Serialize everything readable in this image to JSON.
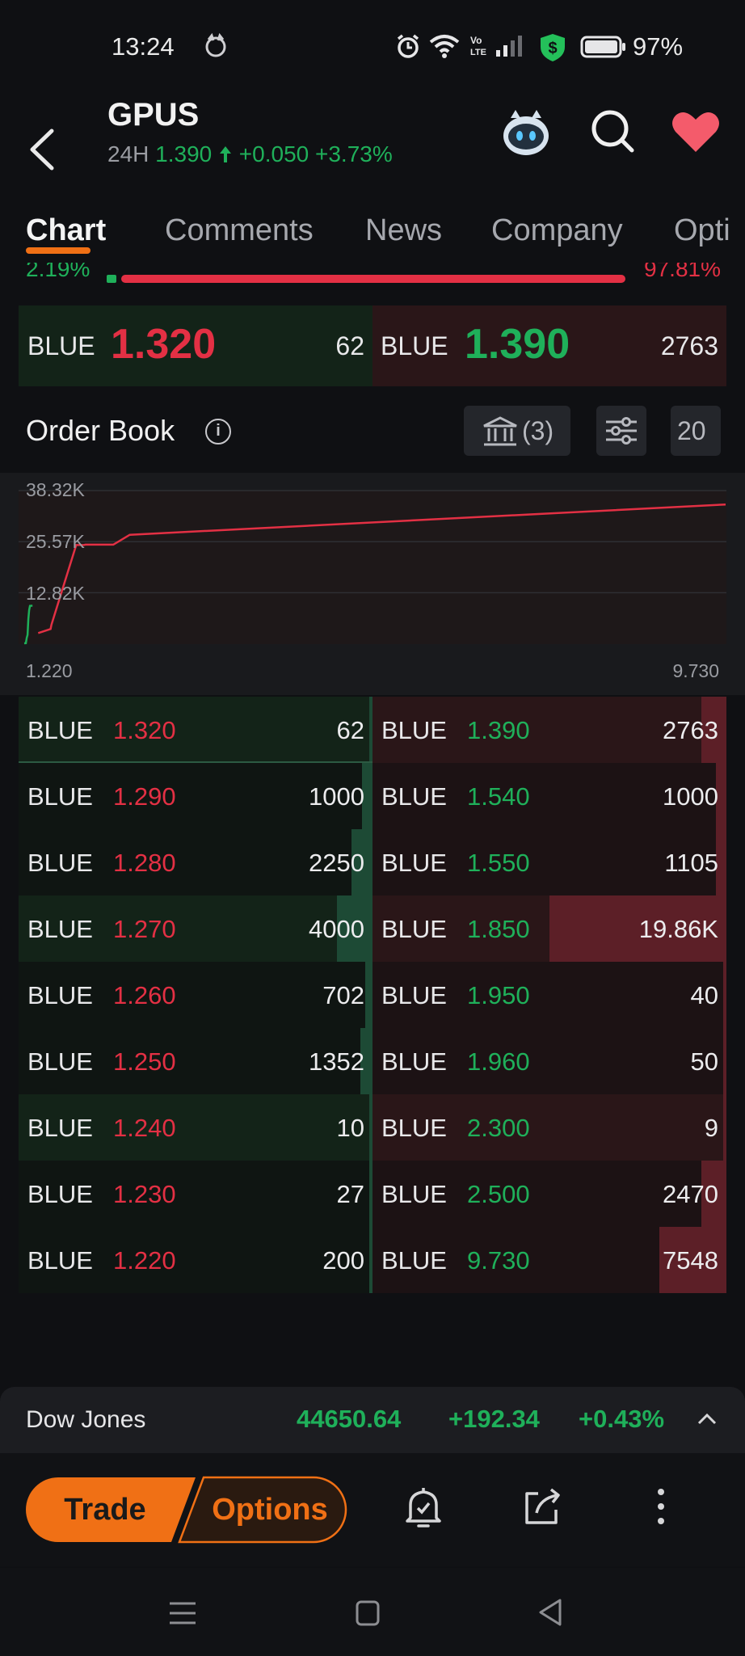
{
  "status_bar": {
    "time": "13:24",
    "battery": "97%",
    "icons": [
      "notification-cat-icon",
      "alarm-icon",
      "wifi-icon",
      "volte-icon",
      "signal-icon",
      "shield-dollar-icon",
      "battery-icon"
    ]
  },
  "header": {
    "symbol": "GPUS",
    "period": "24H",
    "price": "1.390",
    "change": "+0.050",
    "change_pct": "+3.73%",
    "icons": [
      "back-icon",
      "robot-assistant-icon",
      "search-icon",
      "heart-icon"
    ]
  },
  "tabs": [
    {
      "label": "Chart",
      "active": true
    },
    {
      "label": "Comments"
    },
    {
      "label": "News"
    },
    {
      "label": "Company"
    },
    {
      "label": "Opti"
    }
  ],
  "ratio": {
    "bid_pct": "2.19%",
    "ask_pct": "97.81%"
  },
  "best": {
    "bid": {
      "exchange": "BLUE",
      "price": "1.320",
      "size": "62"
    },
    "ask": {
      "exchange": "BLUE",
      "price": "1.390",
      "size": "2763"
    }
  },
  "order_book": {
    "title": "Order Book",
    "brokers_label": "(3)",
    "depth_label": "20",
    "icons": [
      "info-icon",
      "bank-icon",
      "sliders-icon"
    ]
  },
  "depth_chart": {
    "y_ticks": [
      "38.32K",
      "25.57K",
      "12.82K"
    ],
    "x_min": "1.220",
    "x_max": "9.730"
  },
  "chart_data": {
    "type": "area",
    "xlim": [
      1.22,
      9.73
    ],
    "ylim": [
      0,
      38320
    ],
    "series": [
      {
        "points": [
          [
            1.22,
            200
          ],
          [
            1.23,
            227
          ],
          [
            1.24,
            237
          ],
          [
            1.25,
            1589
          ],
          [
            1.26,
            2291
          ],
          [
            1.27,
            6291
          ],
          [
            1.28,
            8541
          ],
          [
            1.29,
            9541
          ],
          [
            1.32,
            9603
          ]
        ]
      },
      {
        "points": [
          [
            1.39,
            2763
          ],
          [
            1.54,
            3763
          ],
          [
            1.55,
            4868
          ],
          [
            1.85,
            24728
          ],
          [
            1.95,
            24768
          ],
          [
            1.96,
            24818
          ],
          [
            2.3,
            24827
          ],
          [
            2.5,
            27297
          ],
          [
            9.73,
            34845
          ]
        ]
      }
    ]
  },
  "book": {
    "bids": [
      {
        "exchange": "BLUE",
        "price": "1.320",
        "size": "62",
        "bar": 0.003
      },
      {
        "exchange": "BLUE",
        "price": "1.290",
        "size": "1000",
        "bar": 0.03
      },
      {
        "exchange": "BLUE",
        "price": "1.280",
        "size": "2250",
        "bar": 0.06
      },
      {
        "exchange": "BLUE",
        "price": "1.270",
        "size": "4000",
        "bar": 0.1
      },
      {
        "exchange": "BLUE",
        "price": "1.260",
        "size": "702",
        "bar": 0.02
      },
      {
        "exchange": "BLUE",
        "price": "1.250",
        "size": "1352",
        "bar": 0.035
      },
      {
        "exchange": "BLUE",
        "price": "1.240",
        "size": "10",
        "bar": 0.003
      },
      {
        "exchange": "BLUE",
        "price": "1.230",
        "size": "27",
        "bar": 0.003
      },
      {
        "exchange": "BLUE",
        "price": "1.220",
        "size": "200",
        "bar": 0.006
      }
    ],
    "asks": [
      {
        "exchange": "BLUE",
        "price": "1.390",
        "size": "2763",
        "bar": 0.07
      },
      {
        "exchange": "BLUE",
        "price": "1.540",
        "size": "1000",
        "bar": 0.03
      },
      {
        "exchange": "BLUE",
        "price": "1.550",
        "size": "1105",
        "bar": 0.03
      },
      {
        "exchange": "BLUE",
        "price": "1.850",
        "size": "19.86K",
        "bar": 0.5
      },
      {
        "exchange": "BLUE",
        "price": "1.950",
        "size": "40",
        "bar": 0.003
      },
      {
        "exchange": "BLUE",
        "price": "1.960",
        "size": "50",
        "bar": 0.003
      },
      {
        "exchange": "BLUE",
        "price": "2.300",
        "size": "9",
        "bar": 0.003
      },
      {
        "exchange": "BLUE",
        "price": "2.500",
        "size": "2470",
        "bar": 0.07
      },
      {
        "exchange": "BLUE",
        "price": "9.730",
        "size": "7548",
        "bar": 0.19
      }
    ]
  },
  "index_ticker": {
    "name": "Dow Jones",
    "value": "44650.64",
    "change": "+192.34",
    "change_pct": "+0.43%",
    "icon": "chevron-up-icon"
  },
  "actions": {
    "trade": "Trade",
    "options": "Options",
    "icons": [
      "alert-bell-icon",
      "share-icon",
      "more-icon"
    ]
  },
  "nav": {
    "icons": [
      "menu-icon",
      "home-icon",
      "back-nav-icon"
    ]
  },
  "colors": {
    "accent": "#f07015",
    "up": "#1fb05a",
    "down": "#e33044",
    "bid_bg": "#132318",
    "ask_bg": "#2a1618",
    "background": "#0f1013"
  }
}
